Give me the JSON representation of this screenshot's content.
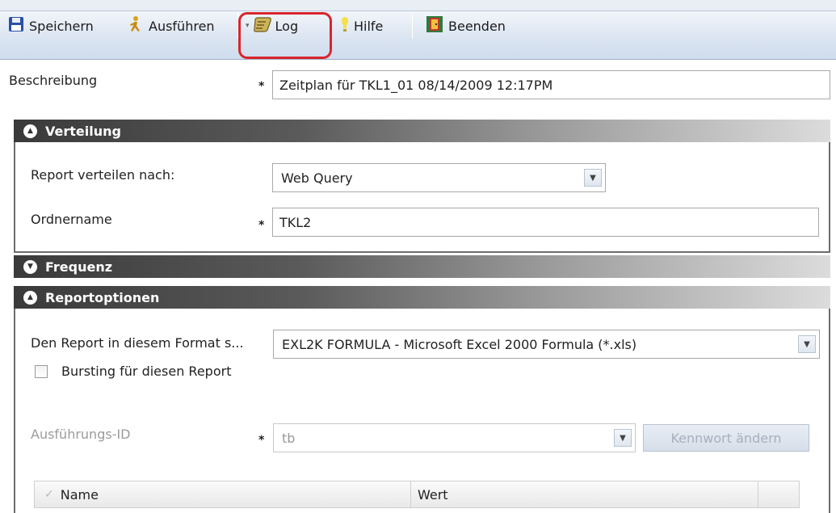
{
  "toolbar": {
    "save_label": "Speichern",
    "run_label": "Ausführen",
    "log_label": "Log",
    "help_label": "Hilfe",
    "exit_label": "Beenden"
  },
  "description": {
    "label": "Beschreibung",
    "value": "Zeitplan für TKL1_01 08/14/2009 12:17PM"
  },
  "sections": {
    "distribution": {
      "title": "Verteilung",
      "expanded": true,
      "distribute_label": "Report verteilen nach:",
      "distribute_value": "Web Query",
      "folder_label": "Ordnername",
      "folder_value": "TKL2"
    },
    "frequency": {
      "title": "Frequenz",
      "expanded": false
    },
    "report_options": {
      "title": "Reportoptionen",
      "expanded": true,
      "format_label": "Den Report in diesem Format s...",
      "format_value": "EXL2K FORMULA - Microsoft Excel 2000 Formula (*.xls)",
      "bursting_label": "Bursting für diesen Report",
      "bursting_checked": false,
      "execution_id_label": "Ausführungs-ID",
      "execution_id_value": "tb",
      "change_password_label": "Kennwort ändern",
      "grid_columns": [
        "Name",
        "Wert"
      ]
    }
  },
  "colors": {
    "toolbar_bg": "#dde6f2",
    "section_header": "#3a3a3a",
    "highlight": "#d8262c"
  }
}
